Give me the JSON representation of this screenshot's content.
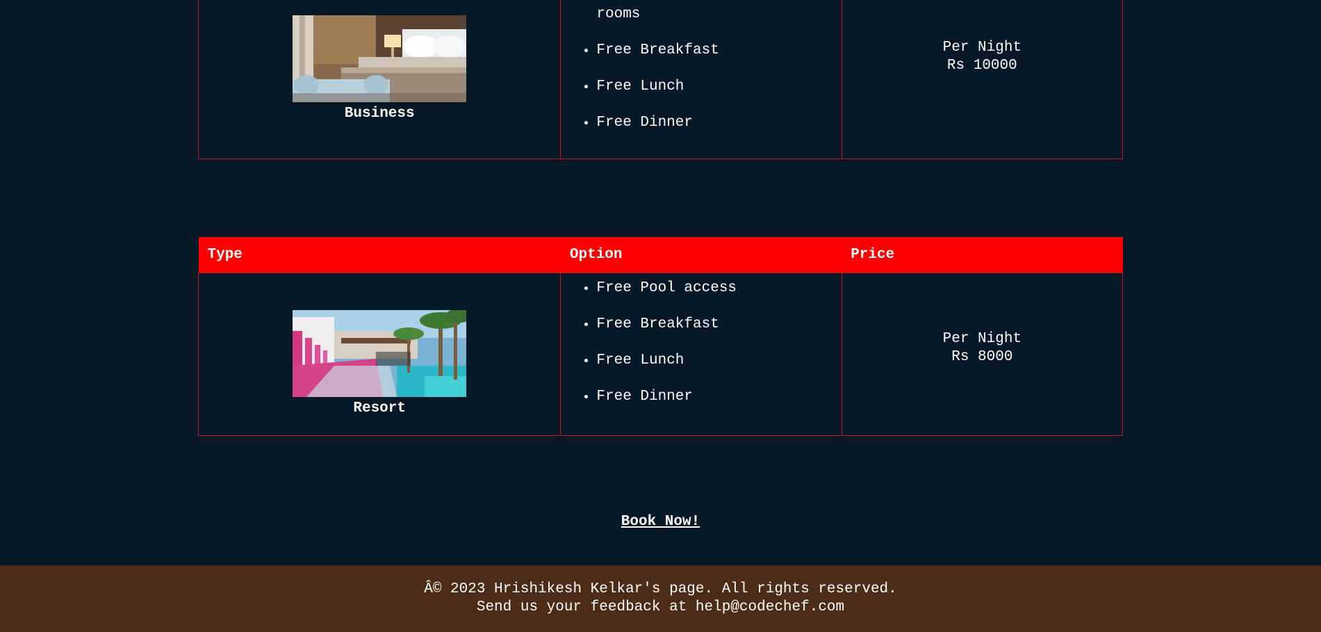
{
  "rooms": [
    {
      "name": "Business",
      "options": [
        "rooms",
        "Free Breakfast",
        "Free Lunch",
        "Free Dinner"
      ],
      "price_label": "Per Night",
      "price": "Rs 10000",
      "image": "hotel-bedroom-photo"
    },
    {
      "name": "Resort",
      "options": [
        "Free Pool access",
        "Free Breakfast",
        "Free Lunch",
        "Free Dinner"
      ],
      "price_label": "Per Night",
      "price": "Rs 8000",
      "image": "resort-pool-photo"
    }
  ],
  "table_headers": {
    "type": "Type",
    "option": "Option",
    "price": "Price"
  },
  "cta": {
    "book_label": "Book Now!"
  },
  "footer": {
    "copyright": "Â© 2023 Hrishikesh Kelkar's page. All rights reserved.",
    "feedback": "Send us your feedback at help@codechef.com"
  },
  "colors": {
    "background": "#071927",
    "accent": "#ff0000",
    "border": "#c8151b",
    "footer_bg": "#4d2b19"
  }
}
